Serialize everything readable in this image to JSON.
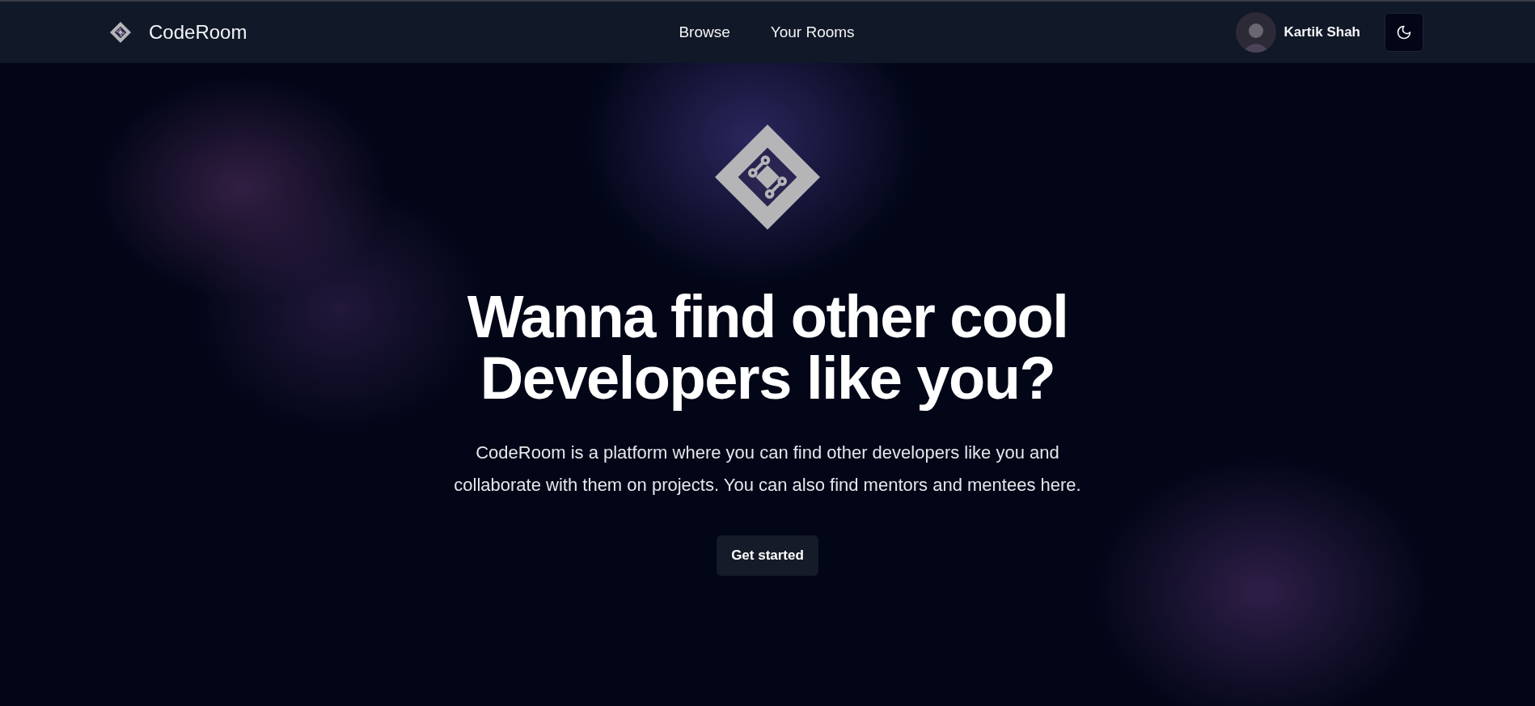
{
  "header": {
    "brand": "CodeRoom",
    "nav": [
      "Browse",
      "Your Rooms"
    ],
    "user": {
      "name": "Kartik Shah"
    }
  },
  "hero": {
    "heading_lines": [
      "Wanna find other cool",
      "Developers like you?"
    ],
    "description": "CodeRoom is a platform where you can find other developers like you and collaborate with them on projects. You can also find mentors and mentees here.",
    "cta": "Get started"
  }
}
